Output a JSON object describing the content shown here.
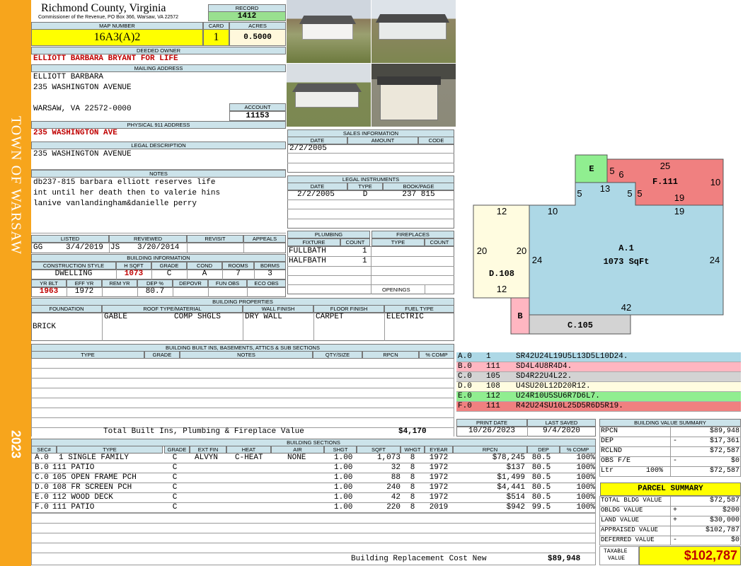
{
  "sidebar": {
    "town": "TOWN OF WARSAW",
    "year": "2023"
  },
  "header": {
    "county": "Richmond County, Virginia",
    "commissioner": "Commissioner of the Revenue, PO Box 366, Warsaw, VA 22572",
    "record_label": "RECORD",
    "record": "1412",
    "map_label": "MAP NUMBER",
    "map_number": "16A3(A)2",
    "card_label": "CARD",
    "card": "1",
    "acres_label": "ACRES",
    "acres": "0.5000"
  },
  "owner": {
    "deeded_label": "DEEDED OWNER",
    "deeded": "ELLIOTT BARBARA BRYANT FOR LIFE",
    "mailing_label": "MAILING ADDRESS",
    "line1": "ELLIOTT BARBARA",
    "line2": "235 WASHINGTON AVENUE",
    "line3": "WARSAW, VA 22572-0000",
    "account_label": "ACCOUNT",
    "account": "11153",
    "physical_label": "PHYSICAL 911 ADDRESS",
    "physical": "235 WASHINGTON AVE",
    "legal_label": "LEGAL DESCRIPTION",
    "legal": "235 WASHINGTON AVENUE"
  },
  "notes": {
    "label": "NOTES",
    "line1": "db237-815 barbara elliott reserves life",
    "line2": "int until her death then to valerie hins",
    "line3": "lanive vanlandingham&danielle perry"
  },
  "review": {
    "listed_label": "LISTED",
    "reviewed_label": "REVIEWED",
    "revisit_label": "REVISIT",
    "appeals_label": "APPEALS",
    "listed_by": "GG",
    "listed_date": "3/4/2019",
    "reviewed_by": "JS",
    "reviewed_date": "3/20/2014"
  },
  "building_info": {
    "label": "BUILDING INFORMATION",
    "h_style": "CONSTRUCTION STYLE",
    "h_sqft": "H SQFT",
    "h_grade": "GRADE",
    "h_cond": "COND",
    "h_rooms": "ROOMS",
    "h_bdrms": "BDRMS",
    "style": "DWELLING",
    "sqft": "1073",
    "grade": "C",
    "cond": "A",
    "rooms": "7",
    "bdrms": "3",
    "h_yrblt": "YR BLT",
    "h_effyr": "EFF YR",
    "h_remyr": "REM YR",
    "h_dep": "DEP %",
    "h_depovr": "DEPOVR",
    "h_funobs": "FUN OBS",
    "h_ecoobs": "ECO OBS",
    "yrblt": "1963",
    "effyr": "1972",
    "dep": "80.7"
  },
  "props": {
    "label": "BUILDING PROPERTIES",
    "h_found": "FOUNDATION",
    "h_roof": "ROOF TYPE/MATERIAL",
    "h_wall": "WALL FINISH",
    "h_floor": "FLOOR FINISH",
    "h_fuel": "FUEL TYPE",
    "found": "BRICK",
    "roof_type": "GABLE",
    "roof_mat": "COMP SHGLS",
    "wall": "DRY WALL",
    "floor": "CARPET",
    "fuel": "ELECTRIC"
  },
  "builtins": {
    "label": "BUILDING BUILT INS, BASEMENTS, ATTICS & SUB SECTIONS",
    "h_type": "TYPE",
    "h_grade": "GRADE",
    "h_notes": "NOTES",
    "h_qty": "QTY/SIZE",
    "h_rpcn": "RPCN",
    "h_comp": "% COMP",
    "total_label": "Total Built Ins, Plumbing & Fireplace Value",
    "total": "$4,170"
  },
  "sales": {
    "label": "SALES INFORMATION",
    "h_date": "DATE",
    "h_amount": "AMOUNT",
    "h_code": "CODE",
    "date": "2/2/2005"
  },
  "legal_inst": {
    "label": "LEGAL INSTRUMENTS",
    "h_date": "DATE",
    "h_type": "TYPE",
    "h_book": "BOOK/PAGE",
    "date": "2/2/2005",
    "type": "D",
    "book": "237 815"
  },
  "plumbing": {
    "label": "PLUMBING",
    "h_fixture": "FIXTURE",
    "h_count": "COUNT",
    "r1_f": "FULLBATH",
    "r1_c": "1",
    "r2_f": "HALFBATH",
    "r2_c": "1"
  },
  "fireplaces": {
    "label": "FIREPLACES",
    "h_type": "TYPE",
    "h_count": "COUNT",
    "openings": "OPENINGS"
  },
  "sketch": {
    "e": "E",
    "f": "F.111",
    "a": "A.1",
    "a_sqft": "1073 SqFt",
    "d": "D.108",
    "b": "B",
    "c": "C.105",
    "n25": "25",
    "n10a": "10",
    "n5a": "5",
    "n6": "6",
    "n13": "13",
    "n5b": "5",
    "n5c": "5",
    "n5d": "5",
    "n19a": "19",
    "n19b": "19",
    "n12a": "12",
    "n10b": "10",
    "n20a": "20",
    "n20b": "20",
    "n24a": "24",
    "n24b": "24",
    "n12b": "12",
    "n42": "42"
  },
  "legend": [
    {
      "code": "A.0",
      "num": "1",
      "desc": "SR42U24L19U5L13D5L10D24.",
      "color": "#add8e6"
    },
    {
      "code": "B.0",
      "num": "111",
      "desc": "SD4L4U8R4D4.",
      "color": "#ffb6c1"
    },
    {
      "code": "C.0",
      "num": "105",
      "desc": "SD4R22U4L22.",
      "color": "#d3d3d3"
    },
    {
      "code": "D.0",
      "num": "108",
      "desc": "U4SU20L12D20R12.",
      "color": "#fffce0"
    },
    {
      "code": "E.0",
      "num": "112",
      "desc": "U24R10U5SU6R7D6L7.",
      "color": "#90ee90"
    },
    {
      "code": "F.0",
      "num": "111",
      "desc": "R42U24SU10L25D5R6D5R19.",
      "color": "#f08080"
    }
  ],
  "print": {
    "print_label": "PRINT DATE",
    "saved_label": "LAST SAVED",
    "print_date": "10/26/2023",
    "last_saved": "9/4/2020"
  },
  "bvs": {
    "label": "BUILDING VALUE SUMMARY",
    "rpcn_l": "RPCN",
    "rpcn": "$89,948",
    "dep_l": "DEP",
    "dep_s": "-",
    "dep": "$17,361",
    "rclnd_l": "RCLND",
    "rclnd": "$72,587",
    "obs_l": "OBS F/E",
    "obs_s": "-",
    "obs": "$0",
    "ltr_l": "Ltr",
    "ltr_p": "100%",
    "ltr": "$72,587"
  },
  "parcel": {
    "label": "PARCEL SUMMARY",
    "tbv_l": "TOTAL BLDG VALUE",
    "tbv": "$72,587",
    "ob_l": "OBLDG VALUE",
    "ob_s": "+",
    "ob": "$200",
    "land_l": "LAND VALUE",
    "land_s": "+",
    "land": "$30,000",
    "app_l": "APPRAISED VALUE",
    "app": "$102,787",
    "def_l": "DEFERRED VALUE",
    "def_s": "-",
    "def": "$0",
    "tax_l1": "TAXABLE",
    "tax_l2": "VALUE",
    "tax": "$102,787"
  },
  "sections": {
    "label": "BUILDING SECTIONS",
    "h": [
      "SEC#",
      "TYPE",
      "GRADE",
      "EXT FIN",
      "HEAT",
      "AIR",
      "SHGT",
      "SQFT",
      "WHGT",
      "EYEAR",
      "RPCN",
      "DEP",
      "% COMP"
    ],
    "rows": [
      [
        "A.0",
        "1 SINGLE FAMILY",
        "C",
        "ALVYN",
        "C-HEAT",
        "NONE",
        "1.00",
        "1,073",
        "8",
        "1972",
        "$78,245",
        "80.5",
        "100%"
      ],
      [
        "B.0",
        "111 PATIO",
        "C",
        "",
        "",
        "",
        "1.00",
        "32",
        "8",
        "1972",
        "$137",
        "80.5",
        "100%"
      ],
      [
        "C.0",
        "105 OPEN FRAME PCH",
        "C",
        "",
        "",
        "",
        "1.00",
        "88",
        "8",
        "1972",
        "$1,499",
        "80.5",
        "100%"
      ],
      [
        "D.0",
        "108 FR SCREEN PCH",
        "C",
        "",
        "",
        "",
        "1.00",
        "240",
        "8",
        "1972",
        "$4,441",
        "80.5",
        "100%"
      ],
      [
        "E.0",
        "112 WOOD DECK",
        "C",
        "",
        "",
        "",
        "1.00",
        "42",
        "8",
        "1972",
        "$514",
        "80.5",
        "100%"
      ],
      [
        "F.0",
        "111 PATIO",
        "C",
        "",
        "",
        "",
        "1.00",
        "220",
        "8",
        "2019",
        "$942",
        "99.5",
        "100%"
      ]
    ],
    "total_label": "Building Replacement Cost New",
    "total": "$89,948"
  }
}
